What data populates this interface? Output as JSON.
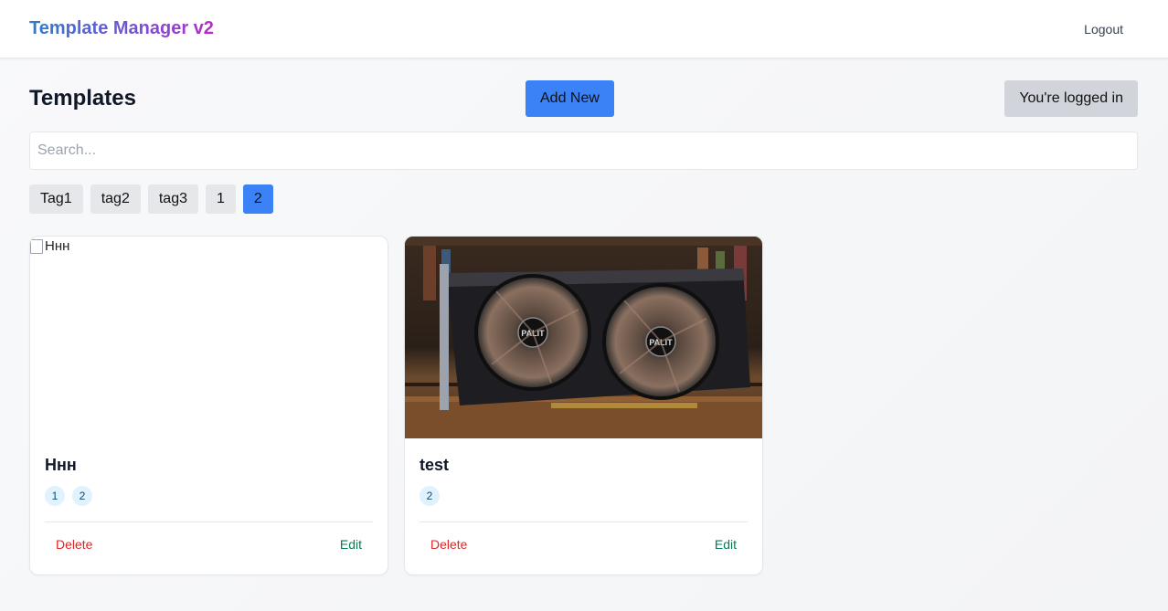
{
  "navbar": {
    "brand": "Template Manager v2",
    "logout_label": "Logout"
  },
  "toolbar": {
    "title": "Templates",
    "add_label": "Add New",
    "login_status": "You're logged in"
  },
  "search": {
    "placeholder": "Search...",
    "value": ""
  },
  "tags": [
    {
      "label": "Tag1",
      "active": false
    },
    {
      "label": "tag2",
      "active": false
    },
    {
      "label": "tag3",
      "active": false
    },
    {
      "label": "1",
      "active": false
    },
    {
      "label": "2",
      "active": true
    }
  ],
  "cards": [
    {
      "image_alt": "Ннн",
      "image_broken": true,
      "title": "Ннн",
      "tags": [
        "1",
        "2"
      ],
      "delete_label": "Delete",
      "edit_label": "Edit"
    },
    {
      "image_alt": "Graphics card with dual fans",
      "image_broken": false,
      "title": "test",
      "tags": [
        "2"
      ],
      "delete_label": "Delete",
      "edit_label": "Edit"
    }
  ],
  "colors": {
    "primary": "#3b82f6",
    "danger": "#dc2626",
    "success": "#047857",
    "tag_bg": "#e5e7eb",
    "chip_bg": "#e0f2fe"
  }
}
